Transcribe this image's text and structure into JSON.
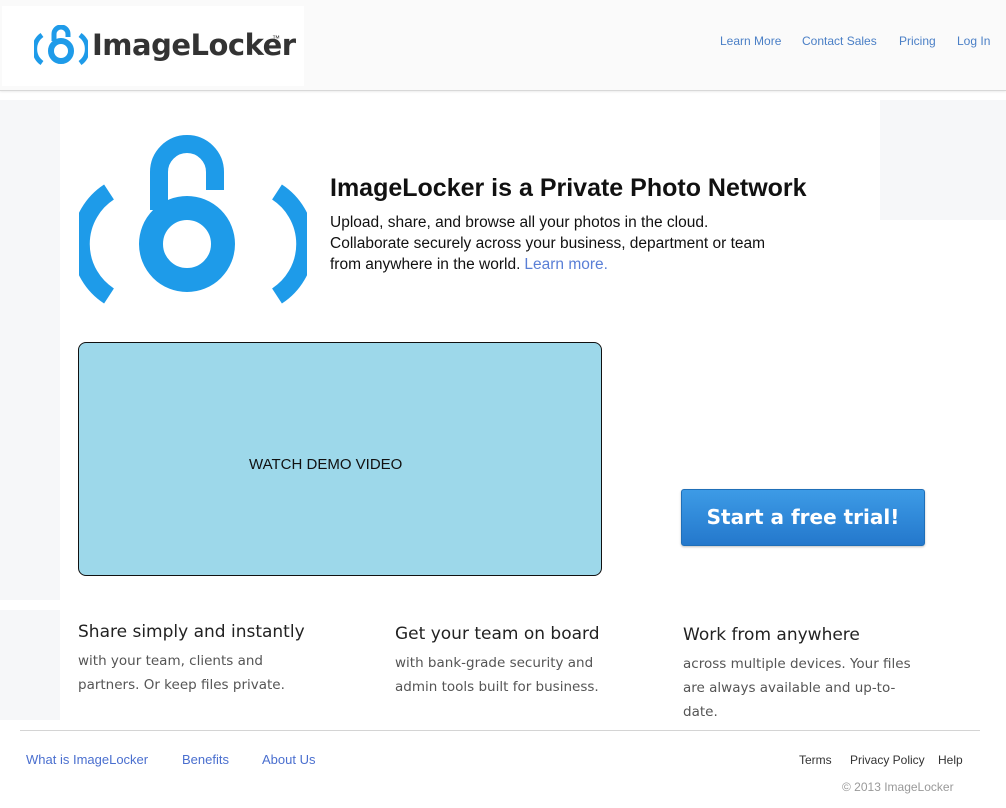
{
  "header": {
    "brand": "ImageLocker",
    "trademark": "™",
    "nav": [
      "Learn More",
      "Contact Sales",
      "Pricing",
      "Log In"
    ]
  },
  "hero": {
    "title": "ImageLocker is a Private Photo Network",
    "lines": [
      "Upload, share, and browse all your photos in the cloud.",
      "Collaborate securely across your business, department or team",
      "from anywhere in the world."
    ],
    "link": "Learn more."
  },
  "video": {
    "label": "WATCH DEMO VIDEO"
  },
  "cta": {
    "label": "Start a free trial!"
  },
  "features": [
    {
      "title": "Share simply and instantly",
      "text": "with your team, clients and partners. Or keep files private."
    },
    {
      "title": "Get your team on board",
      "text": "with bank-grade security and admin tools built for business."
    },
    {
      "title": "Work from anywhere",
      "text": "across multiple devices. Your files are always available and up-to-date."
    }
  ],
  "footer": {
    "left": [
      "What is ImageLocker",
      "Benefits",
      "About Us"
    ],
    "right": [
      "Terms",
      "Privacy Policy",
      "Help"
    ],
    "copyright": "© 2013 ImageLocker"
  },
  "colors": {
    "brand_blue": "#1e9be9",
    "link_blue": "#4a7fc6",
    "video_bg": "#9dd8ea"
  }
}
